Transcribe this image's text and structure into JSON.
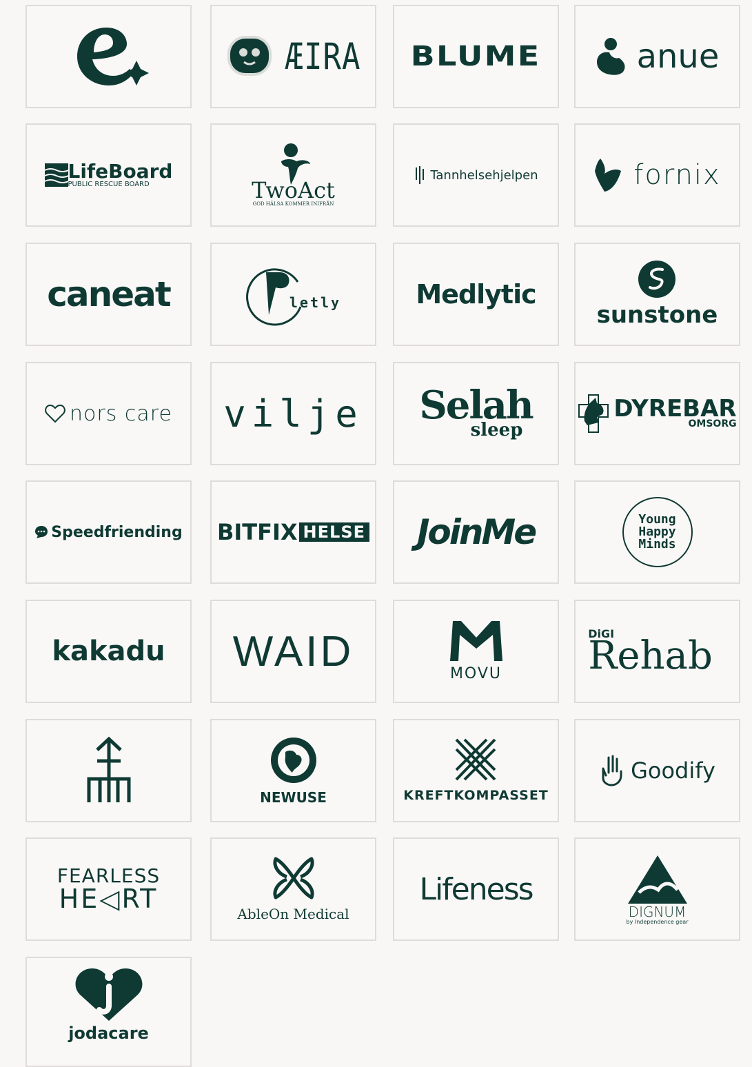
{
  "brand_color": "#0f3a33",
  "partners": {
    "aeira": "ÆIRA",
    "blume": "BLUME",
    "anue": "anue",
    "lifeboard": "LifeBoard",
    "lifeboard_sub": "PUBLIC RESCUE BOARD",
    "twoact": "TwoAct",
    "twoact_sub": "GOD HÄLSA KOMMER INIFRÅN",
    "tannhelsehjelpen": "Tannhelsehjelpen",
    "fornix": "fornix",
    "caneat": "caneat",
    "letly": "letly",
    "medlytic": "Medlytic",
    "sunstone": "sunstone",
    "norscare": "nors care",
    "vilje": "vilje",
    "selah": "Selah",
    "selah_sub": "sleep",
    "dyrebar": "DYREBAR",
    "dyrebar_sub": "OMSORG",
    "speedfriending": "Speedfriending",
    "bitfix": "BITFIX",
    "bitfix_sub": "HELSE",
    "joinme": "JoinMe",
    "yhm_1": "Young",
    "yhm_2": "Happy",
    "yhm_3": "Minds",
    "kakadu": "kakadu",
    "waid": "WAID",
    "movu": "MOVU",
    "digi": "DiGI",
    "rehab": "Rehab",
    "newuse": "NEWUSE",
    "kreftkompasset": "KREFTKOMPASSET",
    "goodify": "Goodify",
    "fearless_1": "FEARLESS",
    "fearless_2": "HE◁RT",
    "ableon": "AbleOn Medical",
    "lifeness": "Lifeness",
    "dignum": "DIGNUM",
    "dignum_sub": "by Independence gear",
    "jodacare": "jodacare"
  }
}
